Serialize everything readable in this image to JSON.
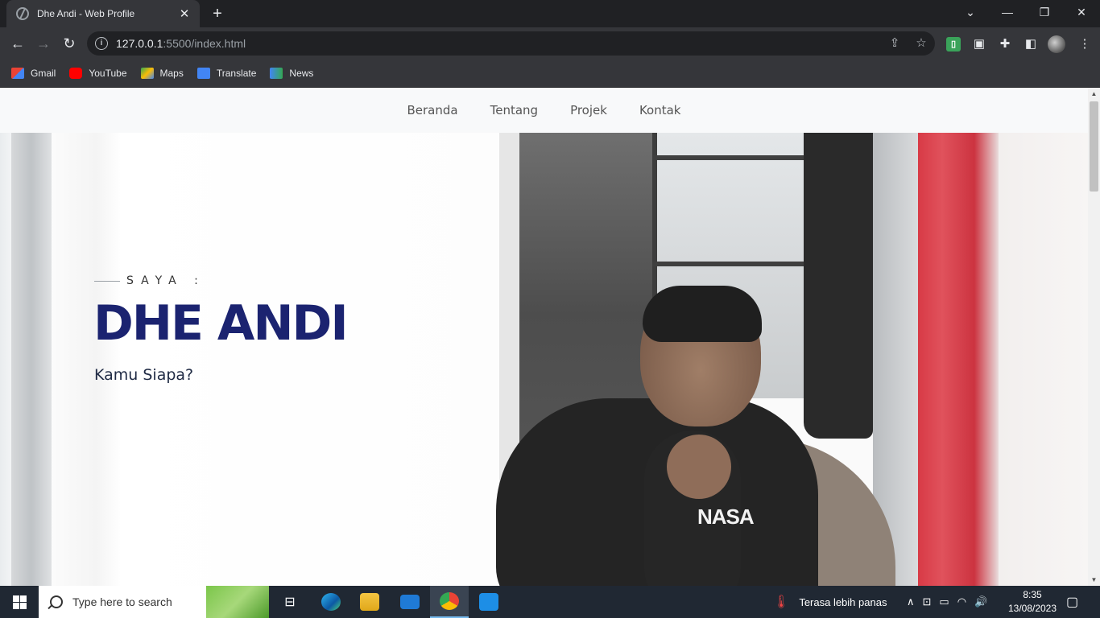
{
  "browser": {
    "tab_title": "Dhe Andi - Web Profile",
    "close_tab_glyph": "✕",
    "new_tab_glyph": "+",
    "url_host": "127.0.0.1",
    "url_rest": ":5500/index.html",
    "window_controls": {
      "tab_search": "⌄",
      "minimize": "—",
      "restore": "❐",
      "close": "✕"
    },
    "bookmarks": [
      {
        "label": "Gmail",
        "color": "#ea4335"
      },
      {
        "label": "YouTube",
        "color": "#ff0000"
      },
      {
        "label": "Maps",
        "color": "#34a853"
      },
      {
        "label": "Translate",
        "color": "#4285f4"
      },
      {
        "label": "News",
        "color": "#4285f4"
      }
    ]
  },
  "page": {
    "nav": [
      "Beranda",
      "Tentang",
      "Projek",
      "Kontak"
    ],
    "hero": {
      "eyebrow": "SAYA :",
      "name": "DHE ANDI",
      "tagline": "Kamu Siapa?",
      "shirt_print": "NASA"
    },
    "colors": {
      "name": "#1b2370",
      "nav_text": "#555555"
    }
  },
  "taskbar": {
    "search_placeholder": "Type here to search",
    "weather_text": "Terasa lebih panas",
    "time": "8:35",
    "date": "13/08/2023"
  }
}
